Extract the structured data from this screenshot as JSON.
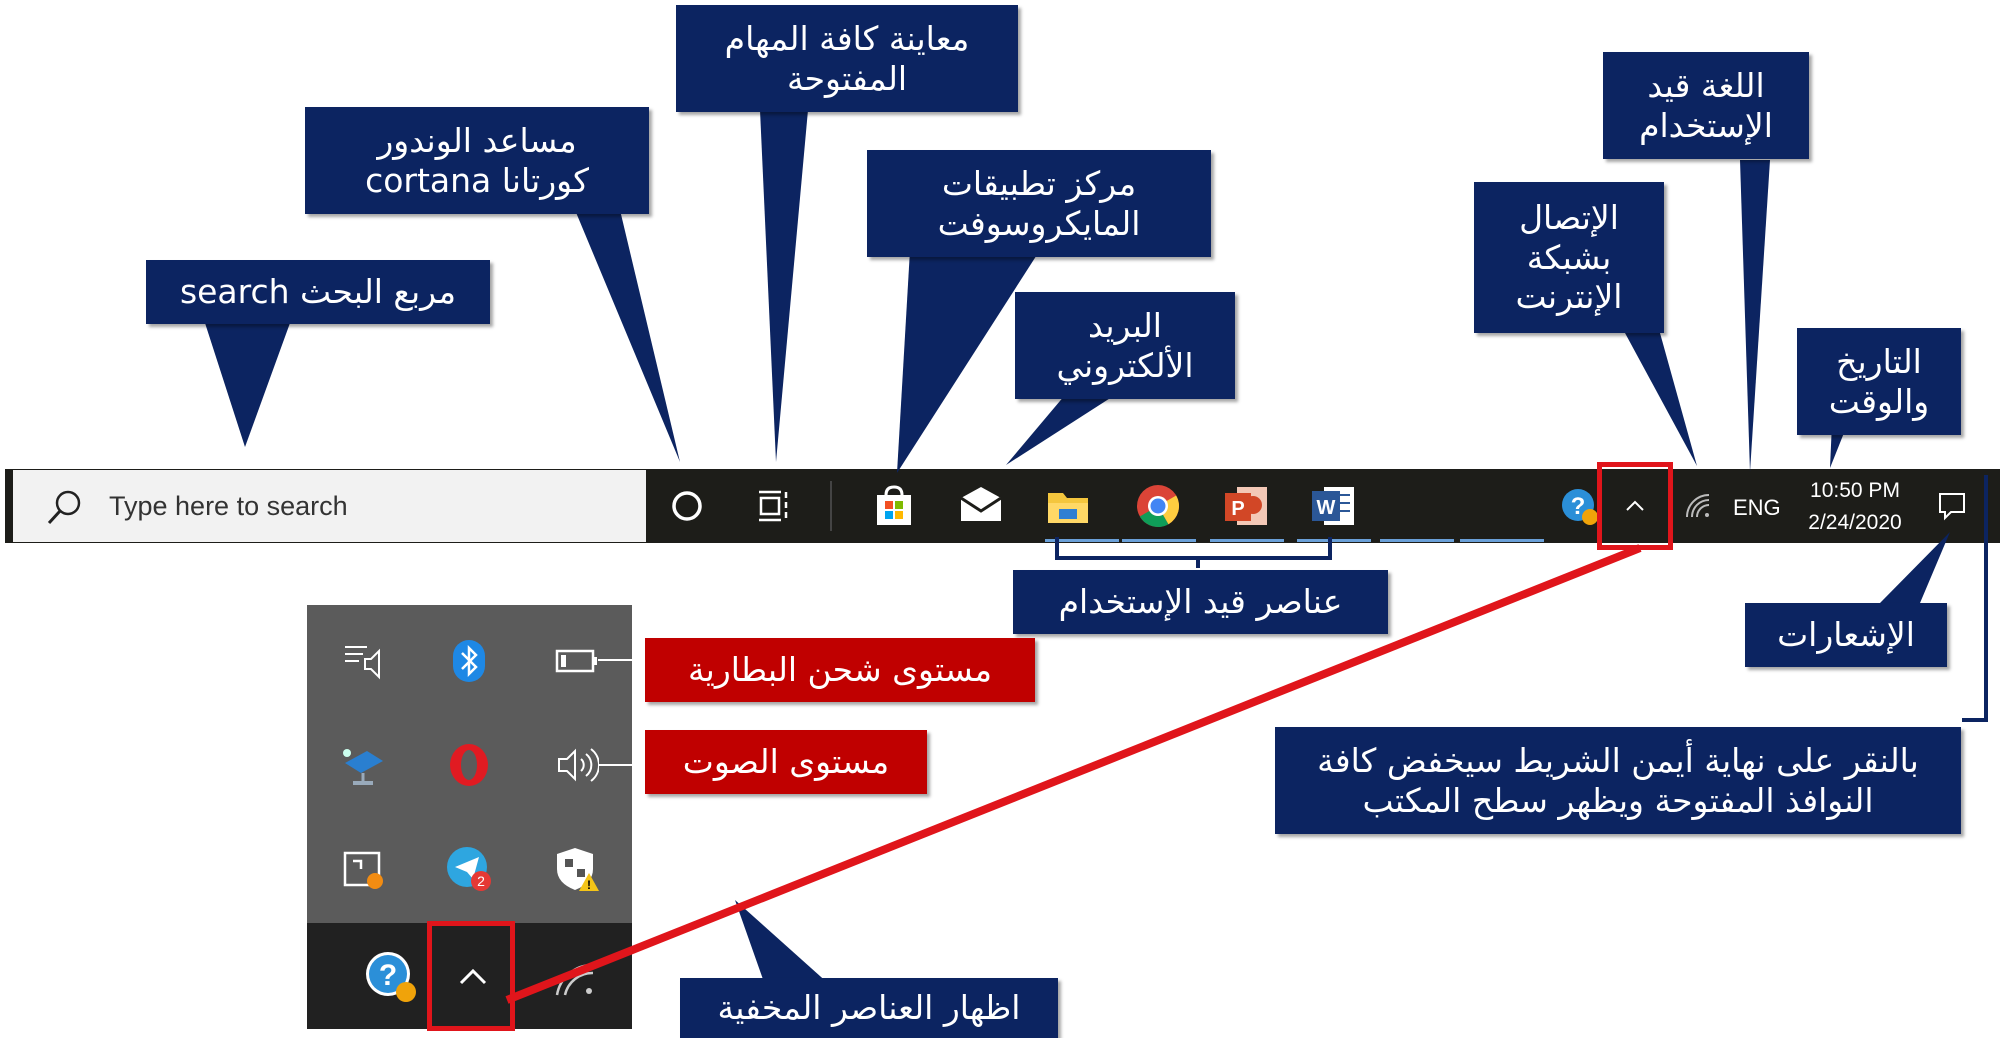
{
  "taskbar": {
    "search_placeholder": "Type here to search",
    "tray": {
      "language": "ENG",
      "time": "10:50 PM",
      "date": "2/24/2020"
    }
  },
  "labels": {
    "search": "مربع البحث search",
    "cortana_line1": "مساعد الوندور",
    "cortana_line2": "كورتانا cortana",
    "task_view_line1": "معاينة كافة المهام",
    "task_view_line2": "المفتوحة",
    "store_line1": "مركز تطبيقات",
    "store_line2": "المايكروسوفت",
    "mail_line1": "البريد",
    "mail_line2": "الألكتروني",
    "network_line1": "الإتصال",
    "network_line2": "بشبكة",
    "network_line3": "الإنترنت",
    "language_line1": "اللغة قيد",
    "language_line2": "الإستخدام",
    "datetime_line1": "التاريخ",
    "datetime_line2": "والوقت",
    "running_apps": "عناصر قيد الإستخدام",
    "notifications": "الإشعارات",
    "show_desktop_line1": "بالنقر على نهاية أيمن الشريط سيخفض كافة",
    "show_desktop_line2": "النوافذ المفتوحة ويظهر سطح المكتب",
    "battery": "مستوى شحن البطارية",
    "volume": "مستوى الصوت",
    "hidden_items": "اظهار العناصر المخفية"
  },
  "popup": {
    "telegram_badge": "2"
  },
  "icons": [
    "search-icon",
    "cortana-icon",
    "task-view-icon",
    "store-icon",
    "mail-icon",
    "file-explorer-icon",
    "chrome-icon",
    "powerpoint-icon",
    "word-icon",
    "help-icon",
    "chevron-up-icon",
    "wifi-icon",
    "notification-icon",
    "display-icon",
    "bluetooth-icon",
    "battery-icon",
    "network-device-icon",
    "opera-icon",
    "volume-icon",
    "capture-icon",
    "telegram-icon",
    "security-icon"
  ],
  "colors": {
    "label_bg": "#0c2461",
    "label_red_bg": "#c00000",
    "highlight_red": "#e0151b",
    "taskbar_bg": "#1d1d19"
  }
}
